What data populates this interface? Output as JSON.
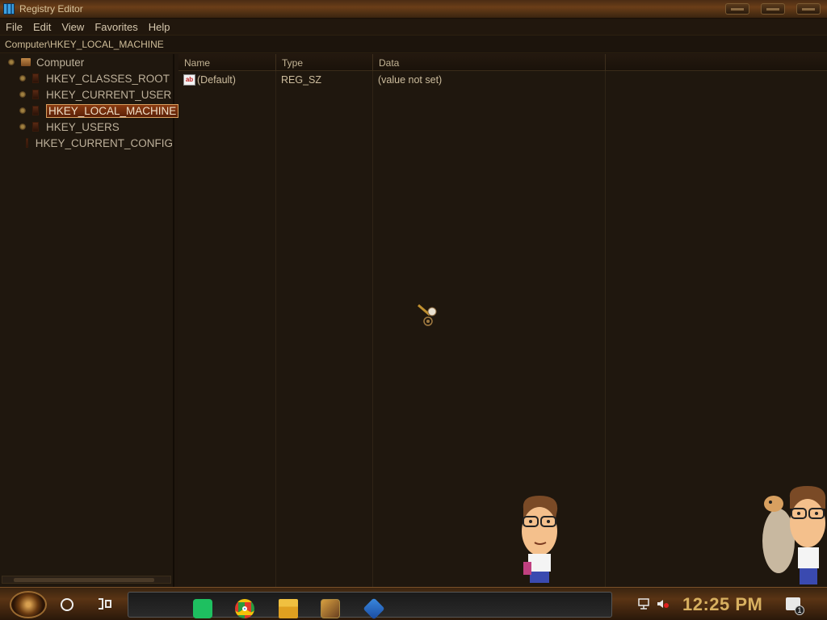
{
  "window": {
    "title": "Registry Editor"
  },
  "menu": {
    "file": "File",
    "edit": "Edit",
    "view": "View",
    "favorites": "Favorites",
    "help": "Help"
  },
  "address": {
    "path": "Computer\\HKEY_LOCAL_MACHINE"
  },
  "tree": {
    "root": "Computer",
    "items": [
      {
        "label": "HKEY_CLASSES_ROOT",
        "selected": false
      },
      {
        "label": "HKEY_CURRENT_USER",
        "selected": false
      },
      {
        "label": "HKEY_LOCAL_MACHINE",
        "selected": true
      },
      {
        "label": "HKEY_USERS",
        "selected": false
      },
      {
        "label": "HKEY_CURRENT_CONFIG",
        "selected": false
      }
    ]
  },
  "list": {
    "columns": {
      "name": "Name",
      "type": "Type",
      "data": "Data"
    },
    "rows": [
      {
        "name": "(Default)",
        "type": "REG_SZ",
        "data": "(value not set)",
        "icon": "string-value-icon"
      }
    ]
  },
  "taskbar": {
    "clock": "12:25 PM",
    "notification_count": "1",
    "pinned": [
      "messaging-app-icon",
      "chrome-icon",
      "file-explorer-icon",
      "game-app-icon",
      "cube-app-icon"
    ],
    "colors": {
      "clock": "#d8b060",
      "selected_row": "#8a3a10"
    }
  }
}
